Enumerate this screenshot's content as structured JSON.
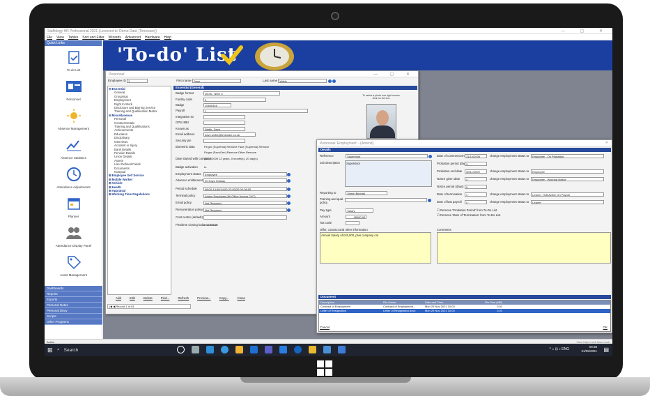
{
  "app": {
    "title": "Staffology HR Professional 2021 (Licensed to 'Demo Data' [Timeware])",
    "menu": [
      "File",
      "View",
      "Tables",
      "Sort and Filter",
      "Wizards",
      "Advanced",
      "Hardware",
      "Help"
    ],
    "window_controls": "— ▢ ✕"
  },
  "quick_links": {
    "header": "Quick Links",
    "items": [
      {
        "label": "To-do List",
        "icon": "clipboard-check-icon"
      },
      {
        "label": "Personnel",
        "icon": "id-card-icon"
      },
      {
        "label": "Absence Management",
        "icon": "sun-icon"
      },
      {
        "label": "Absence Statistics",
        "icon": "line-chart-icon"
      },
      {
        "label": "Attendance Adjustments",
        "icon": "clock-icon"
      },
      {
        "label": "Planner",
        "icon": "calendar-icon"
      },
      {
        "label": "Attendance Display Panel",
        "icon": "people-icon"
      },
      {
        "label": "Asset Management",
        "icon": "tag-icon"
      }
    ],
    "sections": [
      "Dashboards",
      "Reports",
      "Exports",
      "Personal Notes",
      "Personal Diary",
      "Scripts",
      "Other Programs"
    ]
  },
  "banner": {
    "title": "'To-do' List"
  },
  "status": {
    "left": "Action",
    "right": "View   Caps Lock   Num Lock"
  },
  "taskbar": {
    "search": "Search",
    "time": "09:38",
    "date": "21/05/2021",
    "lang": "ENG"
  },
  "personnel": {
    "title": "Personnel",
    "employee_id_label": "Employee ID",
    "employee_id": "1",
    "first_name_label": "First name",
    "first_name": "Dave",
    "last_name_label": "Last name",
    "last_name": "Webb",
    "tree": [
      {
        "group": "Essential",
        "items": [
          "General",
          "Groupings",
          "Employment",
          "Right to Work",
          "Disclosure and Barring Service",
          "Training and Qualification Matrix"
        ]
      },
      {
        "group": "Miscellaneous",
        "items": [
          "Personal",
          "Contact Details",
          "Training and Qualifications",
          "Achievements",
          "Education",
          "Disciplinary",
          "Interviews",
          "Accident or Injury",
          "Bank Details",
          "Pension Details",
          "Union Details",
          "Assets",
          "User Defined Fields",
          "Documents",
          "Notepad"
        ]
      },
      {
        "group": "Employee Self Service",
        "items": []
      },
      {
        "group": "Mobile Worker",
        "items": []
      },
      {
        "group": "Vehicle",
        "items": []
      },
      {
        "group": "Health",
        "items": []
      },
      {
        "group": "Appraisal",
        "items": []
      },
      {
        "group": "Working Time Regulations",
        "items": []
      }
    ],
    "section": "Essential (General)",
    "photo_tip": "To select a photo use right mouse click on the box",
    "fields": [
      {
        "label": "Badge format",
        "value": "26 bit - NHO 3"
      },
      {
        "label": "Facility code",
        "value": "0"
      },
      {
        "label": "Badge",
        "value": "10690345"
      },
      {
        "label": "Payroll",
        "value": "1"
      },
      {
        "label": "Integration ID",
        "value": ""
      },
      {
        "label": "GPS IMEI",
        "value": ""
      },
      {
        "label": "Known as",
        "value": "Webb, Dave"
      },
      {
        "label": "Email address",
        "value": "dave.webb@timeware.co.uk"
      },
      {
        "label": "Security pin",
        "value": ""
      },
      {
        "label": "Biometric data",
        "value": "Finger (Suprema)   Remove   Face (Suprema)   Remove"
      },
      {
        "label": "",
        "value": "Finger (SecuGen)   Remove   Other   Remove"
      },
      {
        "label": "Date started with company",
        "value": "31/10/2009   12 years, 0 month(s), 20 day(s)"
      },
      {
        "label": "Badge activation",
        "value": "to"
      },
      {
        "label": "Employment status",
        "value": "Employee"
      },
      {
        "label": "Absence entitlement policy",
        "value": "20 Days Holiday"
      },
      {
        "label": "Period schedule",
        "value": "08:00-14:00/14:00-22:00/22:00-06:00"
      },
      {
        "label": "Terminal policy",
        "value": "Admin Employee (All Office Access 24/7)"
      },
      {
        "label": "Email policy",
        "value": "Not Required"
      },
      {
        "label": "Remuneration policy",
        "value": "Not Required"
      },
      {
        "label": "Cost centre (default)",
        "value": ""
      },
      {
        "label": "Flexitime closing balance set on",
        "value": "/ /   Amount"
      }
    ],
    "side_labels": [
      "Current employment",
      "Week"
    ],
    "buttons": [
      "Add",
      "Edit",
      "Delete",
      "Find...",
      "Refresh",
      "Preview...",
      "Copy...",
      "Close"
    ],
    "record": "Record 1 of 81"
  },
  "employment": {
    "title": "Personnel 'Employment' - (Amend)",
    "details_header": "Details",
    "left_fields": [
      {
        "label": "Reference",
        "value": "Supervisor"
      },
      {
        "label": "Job description",
        "value": "Supervisor"
      }
    ],
    "reporting_to_label": "Reporting to",
    "reporting_to": "Simon Birchall",
    "training_label": "Training and qual. policy",
    "pay_type_label": "Pay type",
    "pay_type": "Salary",
    "amount_label": "Amount",
    "amount": "45000.00",
    "tax_label": "Tax code",
    "offer_label": "Offer, contract and other information",
    "offer_text": "Annual Salary of £45,000, plus company car",
    "comments_label": "Comments",
    "right_fields": [
      {
        "label": "Date of commencement",
        "value": "31/10/2009",
        "status": "Employee - On Probation"
      },
      {
        "label": "Probation period (days)",
        "value": "3",
        "status": ""
      },
      {
        "label": "Probation end date",
        "value": "30/11/2009",
        "status": "Employee"
      },
      {
        "label": "Notice given date",
        "value": "/ /",
        "status": "Employee - Working Notice"
      },
      {
        "label": "Notice period (days)",
        "value": "0",
        "status": ""
      },
      {
        "label": "Date of termination",
        "value": "/ /",
        "status": "Leaver - Still Active On Payroll"
      },
      {
        "label": "Date of last payroll",
        "value": "/ /",
        "status": "Leaver"
      }
    ],
    "change_label": "change employment status to",
    "checkboxes": [
      "Remove 'Probation Period' from To-Do List",
      "Remove 'Date of Termination' from To-Do List"
    ],
    "doc_header": "Document",
    "doc_columns": [
      "Description",
      "File Name",
      "Date and Time",
      "File Size (MB)"
    ],
    "doc_rows": [
      [
        "Contract of Employment",
        "Contract of Employment...",
        "Mon 29 Nov 2021 10:03",
        "0.01"
      ],
      [
        "Letter of Resignation",
        "Letter of Resignation.docx",
        "Mon 29 Nov 2021 10:03",
        "0.01"
      ]
    ],
    "cancel": "Cancel",
    "ok": "OK"
  }
}
